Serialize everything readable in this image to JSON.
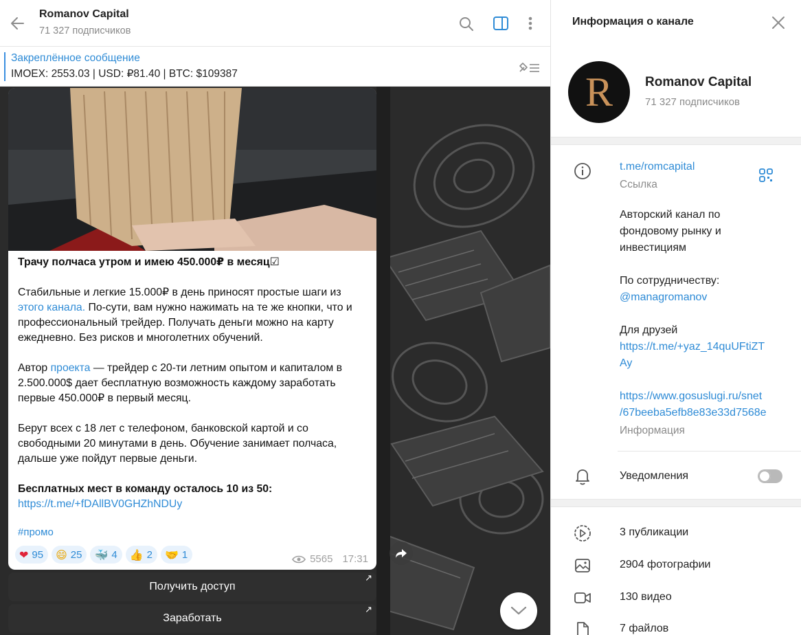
{
  "chat": {
    "title": "Romanov Capital",
    "subscribers": "71 327 подписчиков",
    "icons": [
      "back-arrow-icon",
      "search-icon",
      "sidebar-toggle-icon",
      "more-vertical-icon"
    ]
  },
  "pinned": {
    "label": "Закреплённое сообщение",
    "text": "IMOEX: 2553.03 | USD: ₽81.40 | BTC: $109387"
  },
  "message": {
    "headline": "Трачу полчаса утром и имею 450.000₽ в месяц",
    "headline_emoji": "☑",
    "p1_before": "Стабильные и легкие 15.000₽ в день приносят простые шаги из ",
    "p1_link": "этого канала.",
    "p1_after": " По-сути, вам нужно нажимать на те же кнопки, что и профессиональный трейдер. Получать деньги можно на карту ежедневно. Без рисков и многолетних обучений.",
    "p2_before": "Автор ",
    "p2_link": "проекта",
    "p2_after": "  — трейдер с 20-ти летним опытом и капиталом в 2.500.000$ дает бесплатную возможность каждому заработать первые 450.000₽ в первый месяц.",
    "p3": "Берут всех с 18 лет с телефоном, банковской картой и со свободными 20 минутами в день. Обучение занимает полчаса, дальше уже пойдут первые деньги.",
    "p4": "Бесплатных мест в команду осталось 10 из 50:",
    "p4_link": "https://t.me/+fDAllBV0GHZhNDUy",
    "hashtag": "#промо",
    "reactions": [
      {
        "emoji": "❤",
        "count": "95"
      },
      {
        "emoji": "😄",
        "count": "25"
      },
      {
        "emoji": "🐳",
        "count": "4"
      },
      {
        "emoji": "👍",
        "count": "2"
      },
      {
        "emoji": "🤝",
        "count": "1"
      }
    ],
    "views": "5565",
    "time": "17:31"
  },
  "buttons": {
    "access": "Получить доступ",
    "earn": "Заработать",
    "external_arrow": "↗"
  },
  "info": {
    "title": "Информация о канале",
    "name": "Romanov Capital",
    "subscribers": "71 327 подписчиков",
    "avatar_letter": "R",
    "link": "t.me/romcapital",
    "link_label": "Ссылка",
    "desc": [
      "Авторский канал по",
      "фондовому рынку и",
      "инвестициям"
    ],
    "collab_label": "По сотрудничеству:",
    "collab_handle": "@managromanov",
    "friends_label": "Для друзей",
    "friends_link": [
      "https://t.me/+yaz_14quUFtiZT",
      "Ay"
    ],
    "gos_link": [
      "https://www.gosuslugi.ru/snet",
      "/67beeba5efb8e83e33d7568e"
    ],
    "info_label": "Информация",
    "notifications": "Уведомления",
    "notifications_on": false,
    "media": {
      "posts": "3 публикации",
      "photos": "2904 фотографии",
      "videos": "130 видео",
      "files": "7 файлов"
    }
  },
  "colors": {
    "accent": "#2e8bd6",
    "chat_bg": "#2a2a2a",
    "reaction_bg": "#e8f2fc"
  }
}
